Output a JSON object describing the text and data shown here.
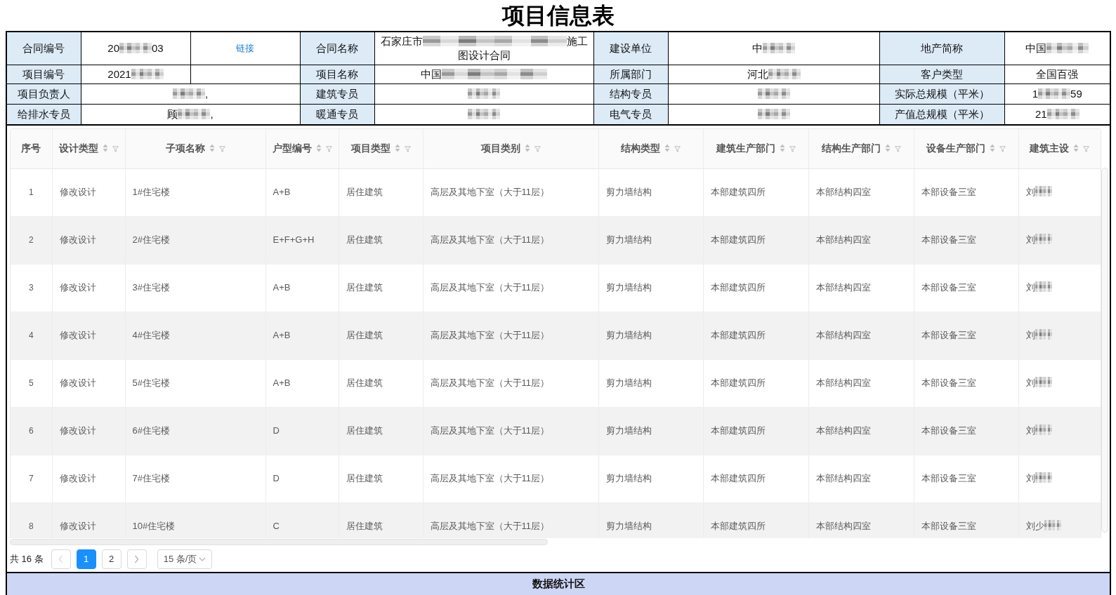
{
  "title": "项目信息表",
  "info_table": {
    "rows": [
      [
        {
          "kind": "label",
          "text": "合同编号"
        },
        {
          "kind": "value",
          "text": "20",
          "redacted": true,
          "text_after": "03"
        },
        {
          "kind": "link",
          "text": "链接"
        },
        {
          "kind": "label",
          "text": "合同名称"
        },
        {
          "kind": "value",
          "text": "石家庄市",
          "redacted": true,
          "text_after": "施工",
          "text_next_line": "图设计合同"
        },
        {
          "kind": "label",
          "text": "建设单位"
        },
        {
          "kind": "value",
          "text": "中",
          "redacted": true
        },
        {
          "kind": "label",
          "text": "地产简称"
        },
        {
          "kind": "value",
          "text": "中国",
          "redacted": true
        }
      ],
      [
        {
          "kind": "label",
          "text": "项目编号"
        },
        {
          "kind": "value",
          "text": "2021",
          "redacted": true
        },
        {
          "kind": "value"
        },
        {
          "kind": "label",
          "text": "项目名称"
        },
        {
          "kind": "value",
          "text": "中国",
          "redacted": true
        },
        {
          "kind": "label",
          "text": "所属部门"
        },
        {
          "kind": "value",
          "text": "河北",
          "redacted": true
        },
        {
          "kind": "label",
          "text": "客户类型"
        },
        {
          "kind": "value",
          "text": "全国百强"
        }
      ],
      [
        {
          "kind": "label",
          "text": "项目负责人"
        },
        {
          "kind": "value",
          "redacted": true,
          "text_after": ",",
          "colspan": 2
        },
        {
          "kind": "label",
          "text": "建筑专员"
        },
        {
          "kind": "value",
          "redacted": true
        },
        {
          "kind": "label",
          "text": "结构专员"
        },
        {
          "kind": "value",
          "redacted": true
        },
        {
          "kind": "label",
          "text": "实际总规模（平米）"
        },
        {
          "kind": "value",
          "text": "1",
          "redacted": true,
          "text_after": "59"
        }
      ],
      [
        {
          "kind": "label",
          "text": "给排水专员"
        },
        {
          "kind": "value",
          "text": "顾",
          "redacted": true,
          "text_after": ",",
          "colspan": 2
        },
        {
          "kind": "label",
          "text": "暖通专员"
        },
        {
          "kind": "value",
          "redacted": true
        },
        {
          "kind": "label",
          "text": "电气专员"
        },
        {
          "kind": "value",
          "redacted": true
        },
        {
          "kind": "label",
          "text": "产值总规模（平米）"
        },
        {
          "kind": "value",
          "text": "21",
          "redacted": true
        }
      ]
    ]
  },
  "table": {
    "columns": [
      {
        "label": "序号",
        "sortable": false,
        "filterable": false
      },
      {
        "label": "设计类型",
        "sortable": true,
        "filterable": true
      },
      {
        "label": "子项名称",
        "sortable": true,
        "filterable": true
      },
      {
        "label": "户型编号",
        "sortable": true,
        "filterable": true
      },
      {
        "label": "项目类型",
        "sortable": true,
        "filterable": true
      },
      {
        "label": "项目类别",
        "sortable": true,
        "filterable": true
      },
      {
        "label": "结构类型",
        "sortable": true,
        "filterable": true
      },
      {
        "label": "建筑生产部门",
        "sortable": true,
        "filterable": true
      },
      {
        "label": "结构生产部门",
        "sortable": true,
        "filterable": true
      },
      {
        "label": "设备生产部门",
        "sortable": true,
        "filterable": true
      },
      {
        "label": "建筑主设",
        "sortable": true,
        "filterable": true
      }
    ],
    "rows": [
      [
        "1",
        "修改设计",
        "1#住宅楼",
        "A+B",
        "居住建筑",
        "高层及其地下室（大于11层）",
        "剪力墙结构",
        "本部建筑四所",
        "本部结构四室",
        "本部设备三室",
        {
          "text": "刘",
          "redacted": true
        }
      ],
      [
        "2",
        "修改设计",
        "2#住宅楼",
        "E+F+G+H",
        "居住建筑",
        "高层及其地下室（大于11层）",
        "剪力墙结构",
        "本部建筑四所",
        "本部结构四室",
        "本部设备三室",
        {
          "text": "刘",
          "redacted": true
        }
      ],
      [
        "3",
        "修改设计",
        "3#住宅楼",
        "A+B",
        "居住建筑",
        "高层及其地下室（大于11层）",
        "剪力墙结构",
        "本部建筑四所",
        "本部结构四室",
        "本部设备三室",
        {
          "text": "刘",
          "redacted": true
        }
      ],
      [
        "4",
        "修改设计",
        "4#住宅楼",
        "A+B",
        "居住建筑",
        "高层及其地下室（大于11层）",
        "剪力墙结构",
        "本部建筑四所",
        "本部结构四室",
        "本部设备三室",
        {
          "text": "刘",
          "redacted": true
        }
      ],
      [
        "5",
        "修改设计",
        "5#住宅楼",
        "A+B",
        "居住建筑",
        "高层及其地下室（大于11层）",
        "剪力墙结构",
        "本部建筑四所",
        "本部结构四室",
        "本部设备三室",
        {
          "text": "刘",
          "redacted": true
        }
      ],
      [
        "6",
        "修改设计",
        "6#住宅楼",
        "D",
        "居住建筑",
        "高层及其地下室（大于11层）",
        "剪力墙结构",
        "本部建筑四所",
        "本部结构四室",
        "本部设备三室",
        {
          "text": "刘",
          "redacted": true
        }
      ],
      [
        "7",
        "修改设计",
        "7#住宅楼",
        "D",
        "居住建筑",
        "高层及其地下室（大于11层）",
        "剪力墙结构",
        "本部建筑四所",
        "本部结构四室",
        "本部设备三室",
        {
          "text": "刘",
          "redacted": true
        }
      ],
      [
        "8",
        "修改设计",
        "10#住宅楼",
        "C",
        "居住建筑",
        "高层及其地下室（大于11层）",
        "剪力墙结构",
        "本部建筑四所",
        "本部结构四室",
        "本部设备三室",
        {
          "text": "刘少",
          "redacted": true
        }
      ]
    ]
  },
  "pagination": {
    "total": "共 16 条",
    "prev": {
      "disabled": true
    },
    "pages": [
      {
        "label": "1",
        "selected": true
      },
      {
        "label": "2",
        "selected": false
      }
    ],
    "next": {
      "disabled": false
    },
    "page_size": "15 条/页"
  },
  "footer_band": {
    "title": "数据统计区"
  }
}
